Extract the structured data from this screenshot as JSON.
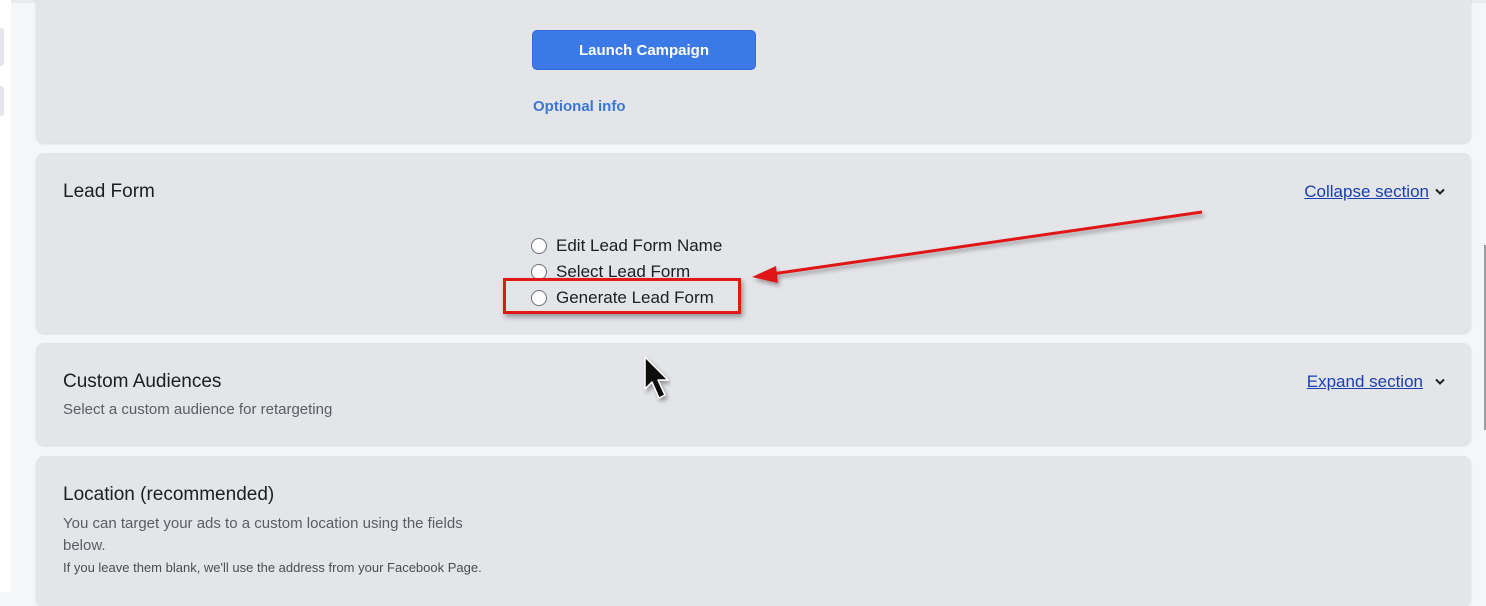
{
  "launch_card": {
    "launch_button_label": "Launch Campaign",
    "optional_link": "Optional info"
  },
  "lead_form": {
    "title": "Lead Form",
    "toggle_label": "Collapse section",
    "options": [
      {
        "label": "Edit Lead Form Name"
      },
      {
        "label": "Select Lead Form"
      },
      {
        "label": "Generate Lead Form"
      }
    ]
  },
  "custom_audiences": {
    "title": "Custom Audiences",
    "subtitle": "Select a custom audience for retargeting",
    "toggle_label": "Expand section"
  },
  "location": {
    "title": "Location (recommended)",
    "description": "You can target your ads to a custom location using the fields below.",
    "note": "If you leave them blank, we'll use the address from your Facebook Page."
  },
  "annotation": {
    "highlight_color": "#e01818",
    "accent_color": "#3b7ae6",
    "link_color": "#1a3fb0"
  }
}
